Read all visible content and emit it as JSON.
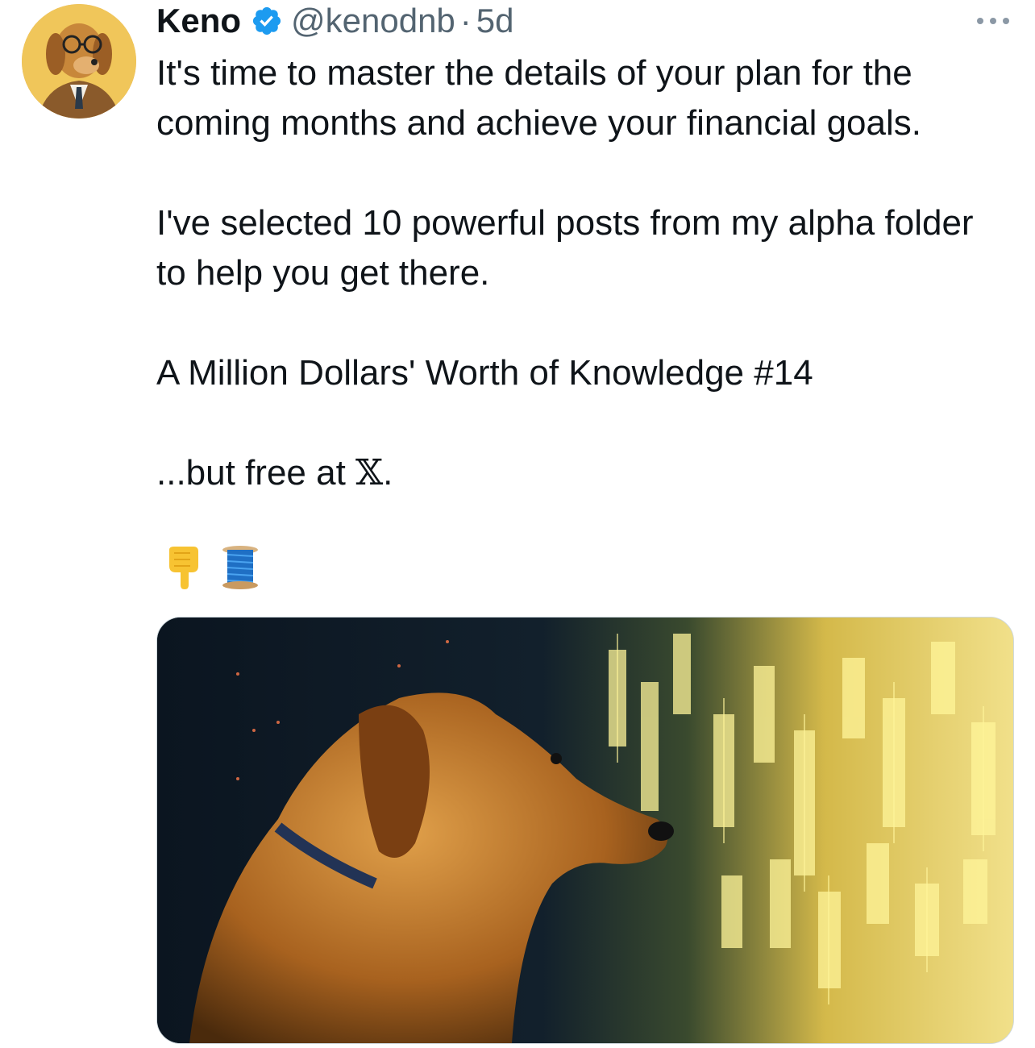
{
  "tweet": {
    "author": {
      "display_name": "Keno",
      "handle": "@kenodnb",
      "verified": true,
      "avatar_icon": "dog-in-suit-avatar"
    },
    "separator": "·",
    "timestamp": "5d",
    "more_icon": "more-options-icon",
    "body": {
      "line1": "It's time to master the details of your plan for the coming months and achieve your financial goals.",
      "line2": "I've selected 10 powerful posts from my alpha folder to help you get there.",
      "line3": "A Million Dollars' Worth of Knowledge #14",
      "line4_prefix": "...but free at ",
      "line4_x": "𝕏",
      "line4_suffix": "."
    },
    "emojis": [
      "pointing-down-emoji",
      "thread-spool-emoji"
    ],
    "media": {
      "type": "image",
      "icon": "golden-retriever-trading-chart-image"
    }
  },
  "colors": {
    "text": "#0f1419",
    "secondary": "#536471",
    "verified_blue": "#1d9bf0"
  }
}
